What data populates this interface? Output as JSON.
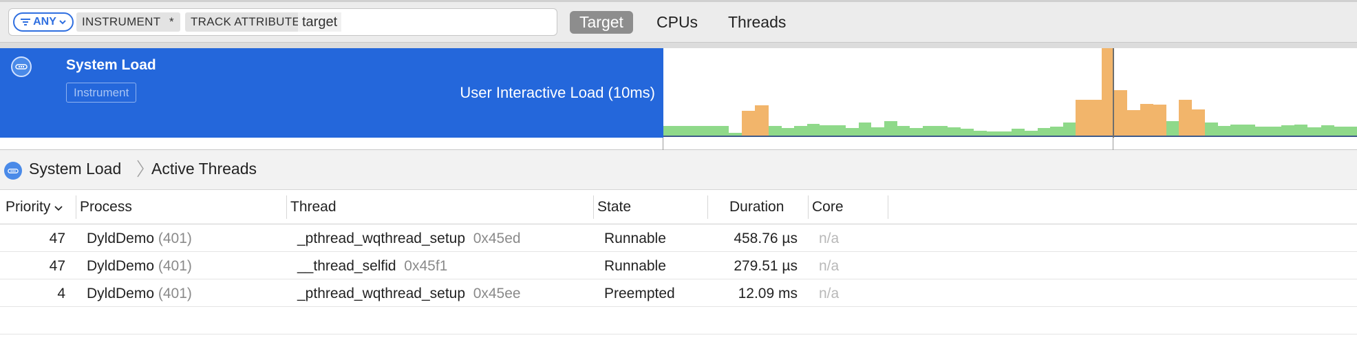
{
  "filter": {
    "any_label": "ANY",
    "tokens": [
      "INSTRUMENT",
      "*",
      "TRACK ATTRIBUTE"
    ],
    "text_value": "target"
  },
  "scope": {
    "items": [
      "Target",
      "CPUs",
      "Threads"
    ],
    "active": "Target"
  },
  "track": {
    "title": "System Load",
    "badge": "Instrument",
    "label": "User Interactive Load (10ms)",
    "colors": {
      "header": "#2467db",
      "normal": "#8fd98a",
      "high": "#f2b56b",
      "baseline": "#3d5a8a"
    }
  },
  "breadcrumb": {
    "root": "System Load",
    "current": "Active Threads"
  },
  "table": {
    "columns": [
      "Priority",
      "Process",
      "Thread",
      "State",
      "Duration",
      "Core"
    ],
    "rows": [
      {
        "priority": "47",
        "process": "DyldDemo",
        "pid": "(401)",
        "thread": "_pthread_wqthread_setup",
        "tid": "0x45ed",
        "state": "Runnable",
        "duration": "458.76 µs",
        "core": "n/a"
      },
      {
        "priority": "47",
        "process": "DyldDemo",
        "pid": "(401)",
        "thread": "__thread_selfid",
        "tid": "0x45f1",
        "state": "Runnable",
        "duration": "279.51 µs",
        "core": "n/a"
      },
      {
        "priority": "4",
        "process": "DyldDemo",
        "pid": "(401)",
        "thread": "_pthread_wqthread_setup",
        "tid": "0x45ee",
        "state": "Preempted",
        "duration": "12.09 ms",
        "core": "n/a"
      }
    ]
  }
}
